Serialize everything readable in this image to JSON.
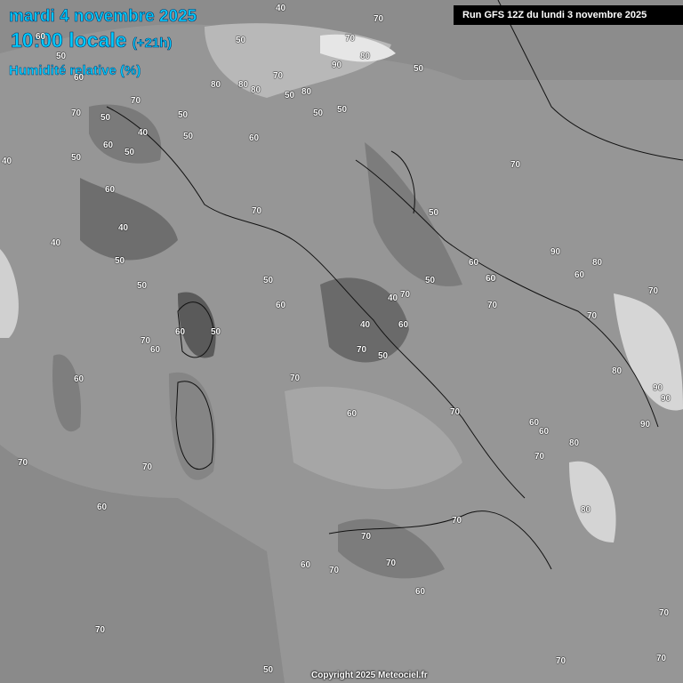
{
  "header": {
    "date": "mardi 4 novembre 2025",
    "time": "10:00 locale",
    "offset": "(+21h)",
    "parameter": "Humidité relative (%)"
  },
  "run_info": "Run GFS 12Z du lundi 3 novembre 2025",
  "copyright": "Copyright 2025 Meteociel.fr",
  "contour_labels": [
    "70",
    "60",
    "50",
    "40",
    "50",
    "70",
    "80",
    "90",
    "50",
    "80",
    "80",
    "80",
    "70",
    "80",
    "50",
    "50",
    "60",
    "50",
    "70",
    "60",
    "50",
    "40",
    "50",
    "70",
    "50",
    "60",
    "50",
    "40",
    "50",
    "70",
    "50",
    "70",
    "50",
    "60",
    "40",
    "40",
    "50",
    "50",
    "60",
    "70",
    "40",
    "40",
    "60",
    "70",
    "50",
    "90",
    "80",
    "60",
    "60",
    "70",
    "70",
    "70",
    "60",
    "60",
    "50",
    "50",
    "60",
    "70",
    "60",
    "60",
    "70",
    "80",
    "90",
    "90",
    "80",
    "90",
    "70",
    "60",
    "60",
    "70",
    "80",
    "60",
    "70",
    "70",
    "70",
    "60",
    "70",
    "60",
    "70",
    "70",
    "70",
    "50",
    "70",
    "60",
    "70",
    "70"
  ]
}
